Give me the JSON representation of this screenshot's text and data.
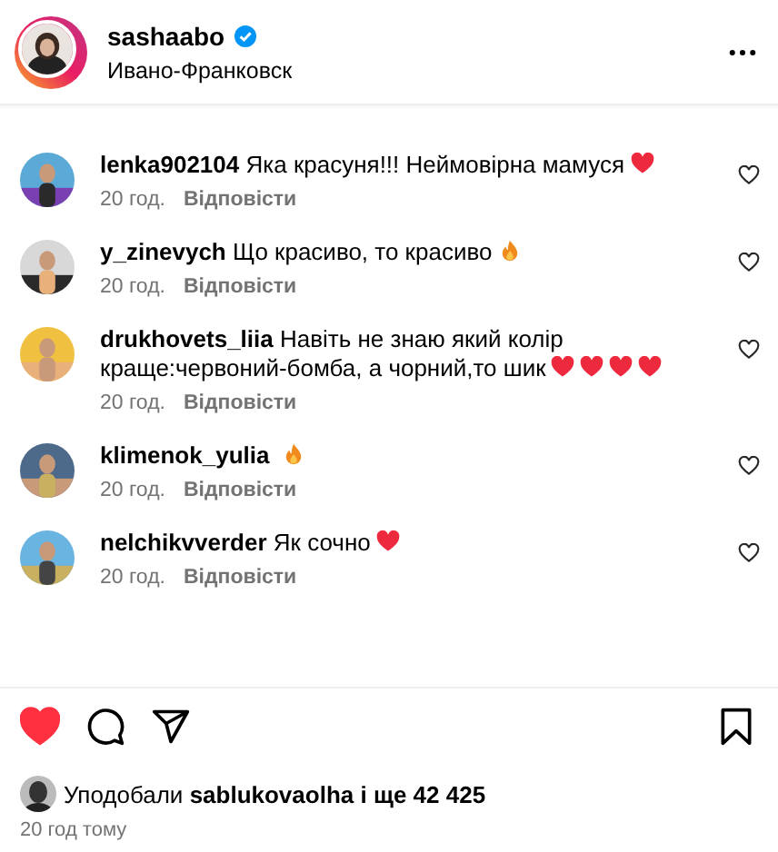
{
  "header": {
    "username": "sashaabo",
    "verified": true,
    "location": "Ивано-Франковск"
  },
  "comments": [
    {
      "username": "lenka902104",
      "text": "Яка красуня!!! Неймовірна мамуся",
      "emojis": [
        {
          "kind": "heart"
        }
      ],
      "time": "20 год.",
      "reply": "Відповісти",
      "liked": false
    },
    {
      "username": "y_zinevych",
      "text": "Що красиво, то красиво",
      "emojis": [
        {
          "kind": "fire"
        }
      ],
      "time": "20 год.",
      "reply": "Відповісти",
      "liked": false
    },
    {
      "username": "drukhovets_liia",
      "text": "Навіть не знаю який колір краще:червоний-бомба, а чорний,то шик",
      "emojis": [
        {
          "kind": "heart"
        },
        {
          "kind": "heart"
        },
        {
          "kind": "heart"
        },
        {
          "kind": "heart"
        }
      ],
      "time": "20 год.",
      "reply": "Відповісти",
      "liked": false
    },
    {
      "username": "klimenok_yulia",
      "emojis": [
        {
          "kind": "fire"
        }
      ],
      "time": "20 год.",
      "reply": "Відповісти",
      "liked": false
    },
    {
      "username": "nelchikvverder",
      "text": "Як сочно",
      "emojis": [
        {
          "kind": "heart"
        }
      ],
      "time": "20 год.",
      "reply": "Відповісти",
      "liked": false
    }
  ],
  "actions": {
    "liked": true,
    "saved": false
  },
  "likes": {
    "prefix": "Уподобали",
    "user": "sablukovaolha",
    "suffix": "і ще 42 425"
  },
  "timestamp": "20 год тому"
}
